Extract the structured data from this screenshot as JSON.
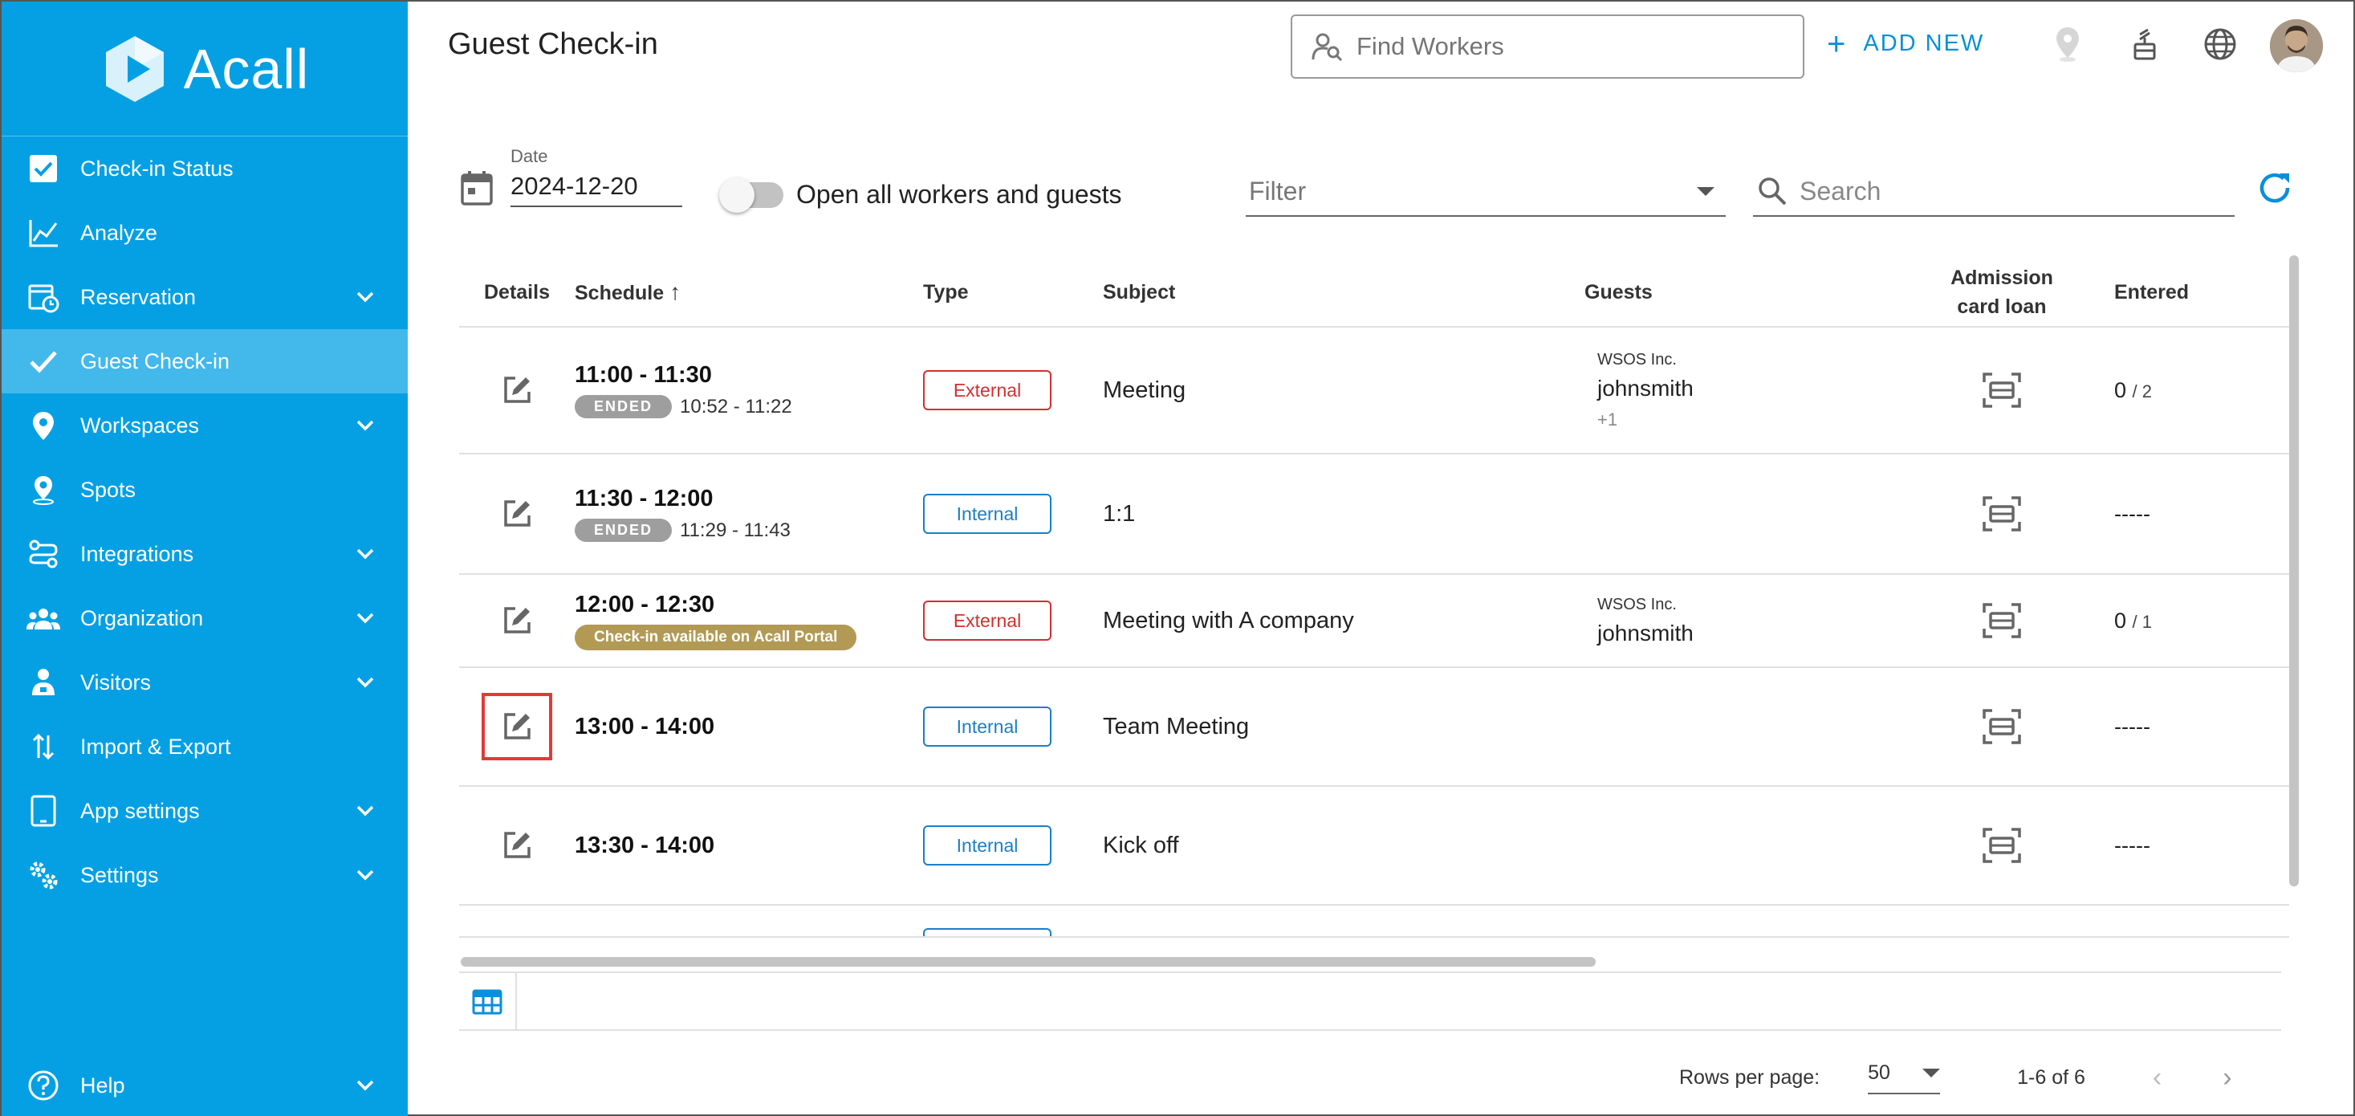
{
  "app": {
    "logo_text": "Acall",
    "brand_color": "#04a0e3"
  },
  "sidebar": {
    "items": [
      {
        "label": "Check-in Status",
        "icon": "check-box-icon",
        "expandable": false,
        "active": false
      },
      {
        "label": "Analyze",
        "icon": "line-chart-icon",
        "expandable": false,
        "active": false
      },
      {
        "label": "Reservation",
        "icon": "calendar-clock-icon",
        "expandable": true,
        "active": false
      },
      {
        "label": "Guest Check-in",
        "icon": "check-icon",
        "expandable": false,
        "active": true
      },
      {
        "label": "Workspaces",
        "icon": "location-pin-icon",
        "expandable": true,
        "active": false
      },
      {
        "label": "Spots",
        "icon": "spot-pin-icon",
        "expandable": false,
        "active": false
      },
      {
        "label": "Integrations",
        "icon": "integrations-icon",
        "expandable": true,
        "active": false
      },
      {
        "label": "Organization",
        "icon": "people-icon",
        "expandable": true,
        "active": false
      },
      {
        "label": "Visitors",
        "icon": "visitor-icon",
        "expandable": true,
        "active": false
      },
      {
        "label": "Import & Export",
        "icon": "import-export-icon",
        "expandable": false,
        "active": false
      },
      {
        "label": "App settings",
        "icon": "tablet-icon",
        "expandable": true,
        "active": false
      },
      {
        "label": "Settings",
        "icon": "gears-icon",
        "expandable": true,
        "active": false
      }
    ],
    "help_label": "Help"
  },
  "header": {
    "title": "Guest Check-in",
    "find_workers_placeholder": "Find Workers",
    "add_new_label": "ADD NEW"
  },
  "toolbar": {
    "date_label": "Date",
    "date_value": "2024-12-20",
    "toggle_label": "Open all workers and guests",
    "toggle_on": false,
    "filter_placeholder": "Filter",
    "search_placeholder": "Search"
  },
  "table": {
    "headers": {
      "details": "Details",
      "schedule": "Schedule",
      "type": "Type",
      "subject": "Subject",
      "guests": "Guests",
      "card_line1": "Admission",
      "card_line2": "card loan",
      "entered": "Entered"
    },
    "rows": [
      {
        "time": "11:00 - 11:30",
        "status": "ENDED",
        "actual": "10:52 - 11:22",
        "type": "External",
        "subject": "Meeting",
        "guest_company": "WSOS Inc.",
        "guest_name": "johnsmith",
        "guest_more": "+1",
        "entered": "0",
        "entered_total": "/ 2"
      },
      {
        "time": "11:30 - 12:00",
        "status": "ENDED",
        "actual": "11:29 - 11:43",
        "type": "Internal",
        "subject": "1:1",
        "guest_company": "",
        "guest_name": "",
        "guest_more": "",
        "entered": "-----",
        "entered_total": ""
      },
      {
        "time": "12:00 - 12:30",
        "status": "Check-in available on Acall Portal",
        "actual": "",
        "type": "External",
        "subject": "Meeting with A company",
        "guest_company": "WSOS Inc.",
        "guest_name": "johnsmith",
        "guest_more": "",
        "entered": "0",
        "entered_total": "/ 1"
      },
      {
        "time": "13:00 - 14:00",
        "status": "",
        "actual": "",
        "type": "Internal",
        "subject": "Team Meeting",
        "guest_company": "",
        "guest_name": "",
        "guest_more": "",
        "entered": "-----",
        "entered_total": ""
      },
      {
        "time": "13:30 - 14:00",
        "status": "",
        "actual": "",
        "type": "Internal",
        "subject": "Kick off",
        "guest_company": "",
        "guest_name": "",
        "guest_more": "",
        "entered": "-----",
        "entered_total": ""
      }
    ]
  },
  "footer": {
    "rows_per_page_label": "Rows per page:",
    "rows_per_page_value": "50",
    "page_info": "1-6 of 6"
  }
}
